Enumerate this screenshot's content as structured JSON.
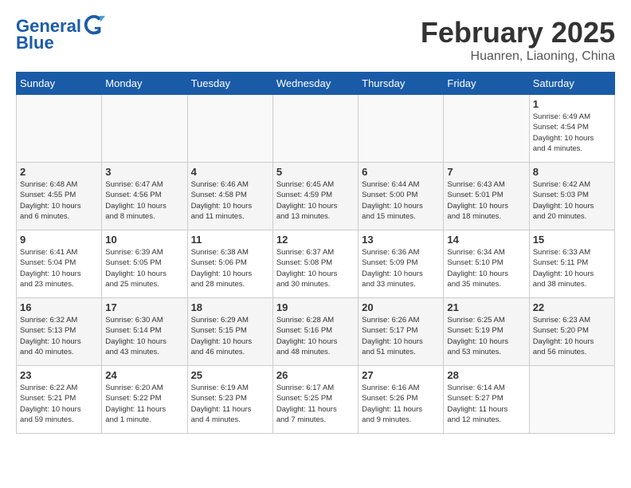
{
  "header": {
    "logo_line1": "General",
    "logo_line2": "Blue",
    "month": "February 2025",
    "location": "Huanren, Liaoning, China"
  },
  "weekdays": [
    "Sunday",
    "Monday",
    "Tuesday",
    "Wednesday",
    "Thursday",
    "Friday",
    "Saturday"
  ],
  "weeks": [
    [
      {
        "day": "",
        "info": ""
      },
      {
        "day": "",
        "info": ""
      },
      {
        "day": "",
        "info": ""
      },
      {
        "day": "",
        "info": ""
      },
      {
        "day": "",
        "info": ""
      },
      {
        "day": "",
        "info": ""
      },
      {
        "day": "1",
        "info": "Sunrise: 6:49 AM\nSunset: 4:54 PM\nDaylight: 10 hours\nand 4 minutes."
      }
    ],
    [
      {
        "day": "2",
        "info": "Sunrise: 6:48 AM\nSunset: 4:55 PM\nDaylight: 10 hours\nand 6 minutes."
      },
      {
        "day": "3",
        "info": "Sunrise: 6:47 AM\nSunset: 4:56 PM\nDaylight: 10 hours\nand 8 minutes."
      },
      {
        "day": "4",
        "info": "Sunrise: 6:46 AM\nSunset: 4:58 PM\nDaylight: 10 hours\nand 11 minutes."
      },
      {
        "day": "5",
        "info": "Sunrise: 6:45 AM\nSunset: 4:59 PM\nDaylight: 10 hours\nand 13 minutes."
      },
      {
        "day": "6",
        "info": "Sunrise: 6:44 AM\nSunset: 5:00 PM\nDaylight: 10 hours\nand 15 minutes."
      },
      {
        "day": "7",
        "info": "Sunrise: 6:43 AM\nSunset: 5:01 PM\nDaylight: 10 hours\nand 18 minutes."
      },
      {
        "day": "8",
        "info": "Sunrise: 6:42 AM\nSunset: 5:03 PM\nDaylight: 10 hours\nand 20 minutes."
      }
    ],
    [
      {
        "day": "9",
        "info": "Sunrise: 6:41 AM\nSunset: 5:04 PM\nDaylight: 10 hours\nand 23 minutes."
      },
      {
        "day": "10",
        "info": "Sunrise: 6:39 AM\nSunset: 5:05 PM\nDaylight: 10 hours\nand 25 minutes."
      },
      {
        "day": "11",
        "info": "Sunrise: 6:38 AM\nSunset: 5:06 PM\nDaylight: 10 hours\nand 28 minutes."
      },
      {
        "day": "12",
        "info": "Sunrise: 6:37 AM\nSunset: 5:08 PM\nDaylight: 10 hours\nand 30 minutes."
      },
      {
        "day": "13",
        "info": "Sunrise: 6:36 AM\nSunset: 5:09 PM\nDaylight: 10 hours\nand 33 minutes."
      },
      {
        "day": "14",
        "info": "Sunrise: 6:34 AM\nSunset: 5:10 PM\nDaylight: 10 hours\nand 35 minutes."
      },
      {
        "day": "15",
        "info": "Sunrise: 6:33 AM\nSunset: 5:11 PM\nDaylight: 10 hours\nand 38 minutes."
      }
    ],
    [
      {
        "day": "16",
        "info": "Sunrise: 6:32 AM\nSunset: 5:13 PM\nDaylight: 10 hours\nand 40 minutes."
      },
      {
        "day": "17",
        "info": "Sunrise: 6:30 AM\nSunset: 5:14 PM\nDaylight: 10 hours\nand 43 minutes."
      },
      {
        "day": "18",
        "info": "Sunrise: 6:29 AM\nSunset: 5:15 PM\nDaylight: 10 hours\nand 46 minutes."
      },
      {
        "day": "19",
        "info": "Sunrise: 6:28 AM\nSunset: 5:16 PM\nDaylight: 10 hours\nand 48 minutes."
      },
      {
        "day": "20",
        "info": "Sunrise: 6:26 AM\nSunset: 5:17 PM\nDaylight: 10 hours\nand 51 minutes."
      },
      {
        "day": "21",
        "info": "Sunrise: 6:25 AM\nSunset: 5:19 PM\nDaylight: 10 hours\nand 53 minutes."
      },
      {
        "day": "22",
        "info": "Sunrise: 6:23 AM\nSunset: 5:20 PM\nDaylight: 10 hours\nand 56 minutes."
      }
    ],
    [
      {
        "day": "23",
        "info": "Sunrise: 6:22 AM\nSunset: 5:21 PM\nDaylight: 10 hours\nand 59 minutes."
      },
      {
        "day": "24",
        "info": "Sunrise: 6:20 AM\nSunset: 5:22 PM\nDaylight: 11 hours\nand 1 minute."
      },
      {
        "day": "25",
        "info": "Sunrise: 6:19 AM\nSunset: 5:23 PM\nDaylight: 11 hours\nand 4 minutes."
      },
      {
        "day": "26",
        "info": "Sunrise: 6:17 AM\nSunset: 5:25 PM\nDaylight: 11 hours\nand 7 minutes."
      },
      {
        "day": "27",
        "info": "Sunrise: 6:16 AM\nSunset: 5:26 PM\nDaylight: 11 hours\nand 9 minutes."
      },
      {
        "day": "28",
        "info": "Sunrise: 6:14 AM\nSunset: 5:27 PM\nDaylight: 11 hours\nand 12 minutes."
      },
      {
        "day": "",
        "info": ""
      }
    ]
  ]
}
